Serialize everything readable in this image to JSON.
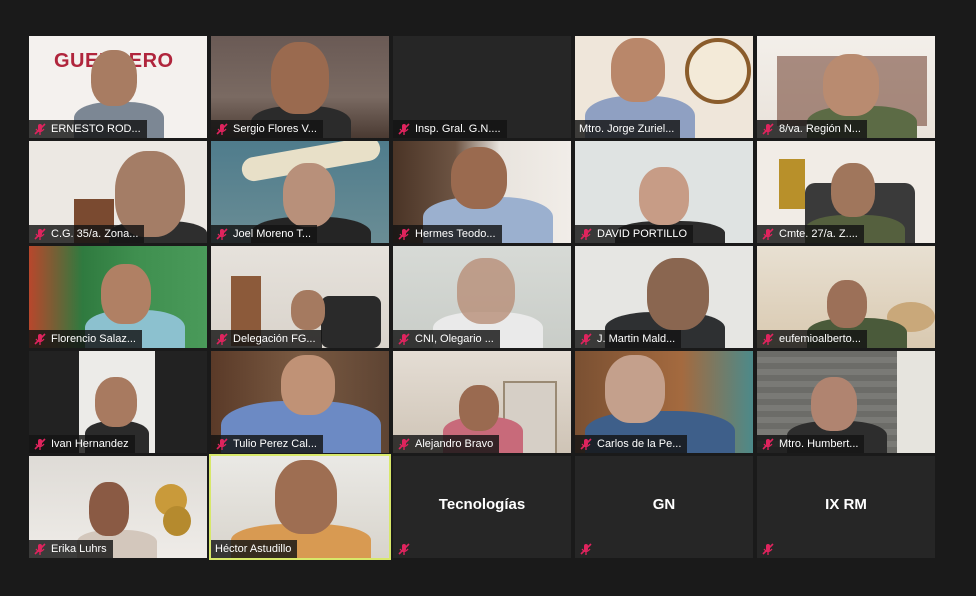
{
  "participants": [
    {
      "name": "ERNESTO ROD...",
      "muted": true
    },
    {
      "name": "Sergio Flores V...",
      "muted": true
    },
    {
      "name": "Insp. Gral. G.N....",
      "muted": true
    },
    {
      "name": "Mtro. Jorge Zuriel...",
      "muted": false
    },
    {
      "name": "8/va. Región N...",
      "muted": true
    },
    {
      "name": "C.G. 35/a. Zona...",
      "muted": true
    },
    {
      "name": "Joel Moreno T...",
      "muted": true
    },
    {
      "name": "Hermes Teodo...",
      "muted": true
    },
    {
      "name": "DAVID PORTILLO",
      "muted": true
    },
    {
      "name": "Cmte. 27/a. Z....",
      "muted": true
    },
    {
      "name": "Florencio Salaz...",
      "muted": true
    },
    {
      "name": "Delegación FG...",
      "muted": true
    },
    {
      "name": "CNI, Olegario ...",
      "muted": true
    },
    {
      "name": "J. Martin Mald...",
      "muted": true
    },
    {
      "name": "eufemioalberto...",
      "muted": true
    },
    {
      "name": "Ivan Hernandez",
      "muted": true
    },
    {
      "name": "Tulio Perez Cal...",
      "muted": true
    },
    {
      "name": "Alejandro Bravo",
      "muted": true
    },
    {
      "name": "Carlos de la Pe...",
      "muted": true
    },
    {
      "name": "Mtro. Humbert...",
      "muted": true
    },
    {
      "name": "Erika Luhrs",
      "muted": true
    },
    {
      "name": "Héctor Astudillo",
      "muted": false,
      "active_speaker": true
    },
    {
      "name": "Tecnologías",
      "muted": true,
      "video_off": true
    },
    {
      "name": "GN",
      "muted": true,
      "video_off": true
    },
    {
      "name": "IX RM",
      "muted": true,
      "video_off": true
    }
  ],
  "logo_text": "GUERRERO",
  "colors": {
    "active_border": "#d8e86a",
    "mute_icon": "#e0245e",
    "background": "#1a1a1a"
  },
  "icons": {
    "mute": "microphone-muted-icon"
  }
}
